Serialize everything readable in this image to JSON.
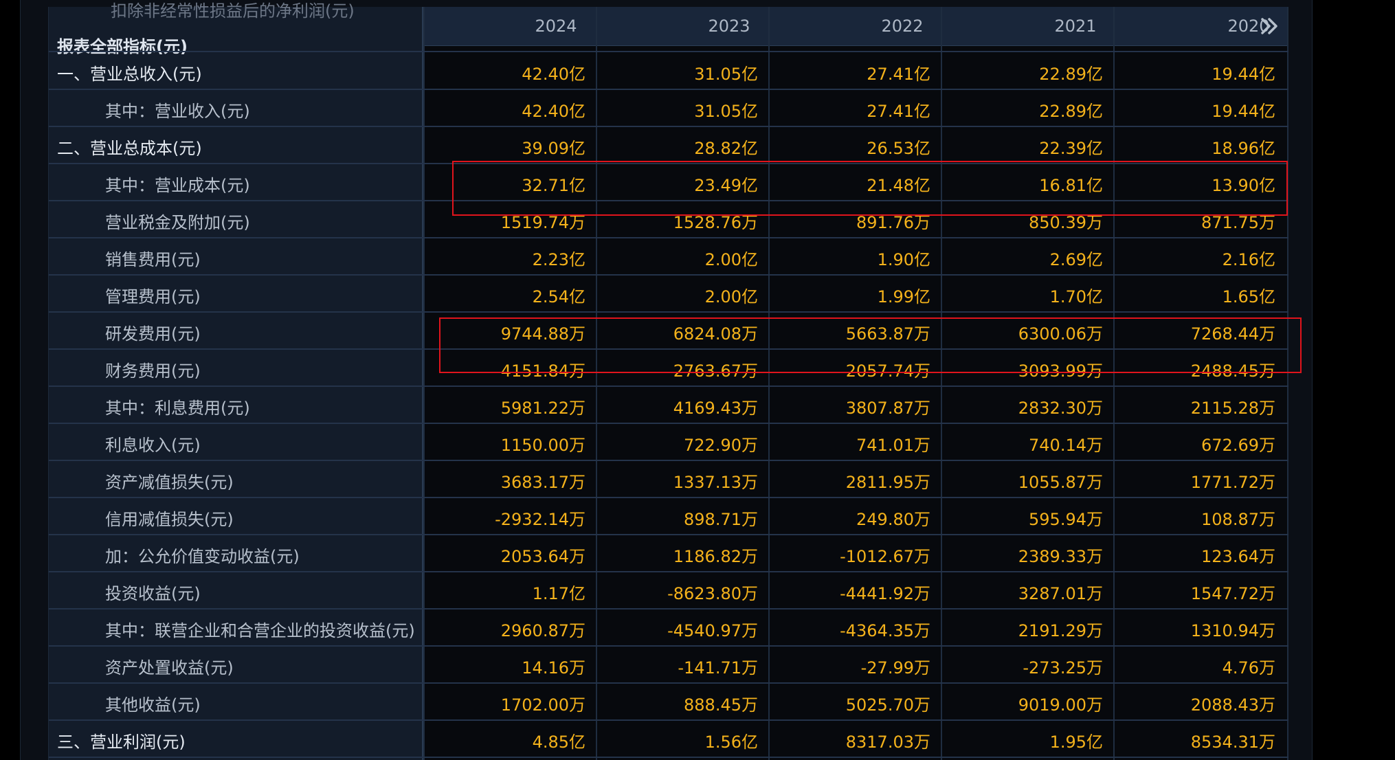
{
  "header": {
    "top_label": "扣除非经常性损益后的净利润(元)",
    "section_title": "报表全部指标(元)",
    "years": [
      "2024",
      "2023",
      "2022",
      "2021",
      "2020"
    ],
    "next_icon": "chevron-double-right-icon"
  },
  "rows": [
    {
      "label": "一、营业总收入(元)",
      "level": "main",
      "values": [
        "42.40亿",
        "31.05亿",
        "27.41亿",
        "22.89亿",
        "19.44亿"
      ]
    },
    {
      "label": "其中：营业收入(元)",
      "level": "sub",
      "values": [
        "42.40亿",
        "31.05亿",
        "27.41亿",
        "22.89亿",
        "19.44亿"
      ]
    },
    {
      "label": "二、营业总成本(元)",
      "level": "main",
      "values": [
        "39.09亿",
        "28.82亿",
        "26.53亿",
        "22.39亿",
        "18.96亿"
      ]
    },
    {
      "label": "其中：营业成本(元)",
      "level": "sub",
      "values": [
        "32.71亿",
        "23.49亿",
        "21.48亿",
        "16.81亿",
        "13.90亿"
      ]
    },
    {
      "label": "营业税金及附加(元)",
      "level": "sub",
      "values": [
        "1519.74万",
        "1528.76万",
        "891.76万",
        "850.39万",
        "871.75万"
      ]
    },
    {
      "label": "销售费用(元)",
      "level": "sub",
      "values": [
        "2.23亿",
        "2.00亿",
        "1.90亿",
        "2.69亿",
        "2.16亿"
      ]
    },
    {
      "label": "管理费用(元)",
      "level": "sub",
      "values": [
        "2.54亿",
        "2.00亿",
        "1.99亿",
        "1.70亿",
        "1.65亿"
      ]
    },
    {
      "label": "研发费用(元)",
      "level": "sub",
      "values": [
        "9744.88万",
        "6824.08万",
        "5663.87万",
        "6300.06万",
        "7268.44万"
      ]
    },
    {
      "label": "财务费用(元)",
      "level": "sub",
      "values": [
        "4151.84万",
        "2763.67万",
        "2057.74万",
        "3093.99万",
        "2488.45万"
      ]
    },
    {
      "label": "其中：利息费用(元)",
      "level": "sub",
      "values": [
        "5981.22万",
        "4169.43万",
        "3807.87万",
        "2832.30万",
        "2115.28万"
      ]
    },
    {
      "label": "利息收入(元)",
      "level": "sub",
      "values": [
        "1150.00万",
        "722.90万",
        "741.01万",
        "740.14万",
        "672.69万"
      ]
    },
    {
      "label": "资产减值损失(元)",
      "level": "sub",
      "values": [
        "3683.17万",
        "1337.13万",
        "2811.95万",
        "1055.87万",
        "1771.72万"
      ]
    },
    {
      "label": "信用减值损失(元)",
      "level": "sub",
      "values": [
        "-2932.14万",
        "898.71万",
        "249.80万",
        "595.94万",
        "108.87万"
      ]
    },
    {
      "label": "加：公允价值变动收益(元)",
      "level": "sub",
      "values": [
        "2053.64万",
        "1186.82万",
        "-1012.67万",
        "2389.33万",
        "123.64万"
      ]
    },
    {
      "label": "投资收益(元)",
      "level": "sub",
      "values": [
        "1.17亿",
        "-8623.80万",
        "-4441.92万",
        "3287.01万",
        "1547.72万"
      ]
    },
    {
      "label": "其中：联营企业和合营企业的投资收益(元)",
      "level": "sub",
      "values": [
        "2960.87万",
        "-4540.97万",
        "-4364.35万",
        "2191.29万",
        "1310.94万"
      ]
    },
    {
      "label": "资产处置收益(元)",
      "level": "sub",
      "values": [
        "14.16万",
        "-141.71万",
        "-27.99万",
        "-273.25万",
        "4.76万"
      ]
    },
    {
      "label": "其他收益(元)",
      "level": "sub",
      "values": [
        "1702.00万",
        "888.45万",
        "5025.70万",
        "9019.00万",
        "2088.43万"
      ]
    },
    {
      "label": "三、营业利润(元)",
      "level": "main",
      "values": [
        "4.85亿",
        "1.56亿",
        "8317.03万",
        "1.95亿",
        "8534.31万"
      ]
    }
  ],
  "colors": {
    "value": "#f4b21b",
    "highlight": "#e0141c",
    "background": "#07090d",
    "header": "#19263a"
  }
}
